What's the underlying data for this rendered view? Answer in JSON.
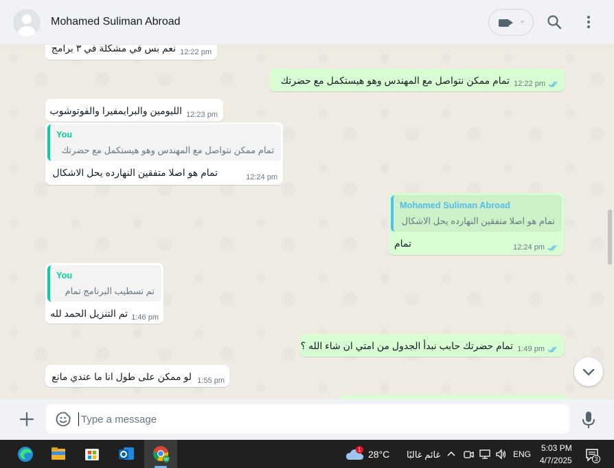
{
  "header": {
    "contact_name": "Mohamed Suliman Abroad",
    "icons": [
      "avatar-icon",
      "video-call-icon",
      "chevron-down-icon",
      "search-icon",
      "menu-icon"
    ]
  },
  "messages": [
    {
      "dir": "in",
      "text": "نعم بس في مشكلة في ٣ برامج",
      "time": "12:22 pm"
    },
    {
      "dir": "out",
      "text": "تمام ممكن نتواصل مع المهندس وهو هيستكمل مع حضرتك",
      "time": "12:22 pm"
    },
    {
      "dir": "in",
      "text": "الليومين والبرايمفيرا والفوتوشوب",
      "time": "12:23 pm"
    },
    {
      "dir": "in",
      "quote_author": "You",
      "quote_text": "تمام ممكن نتواصل مع المهندس وهو هيستكمل مع حضرتك",
      "text": "تمام هو اصلا متفقين النهارده يحل الاشكال",
      "time": "12:24 pm"
    },
    {
      "dir": "out",
      "quote_author": "Mohamed Suliman Abroad",
      "quote_text": "تمام هو اصلا متفقين النهارده يحل الاشكال",
      "text": "تمام",
      "time": "12:24 pm"
    },
    {
      "dir": "in",
      "quote_author": "You",
      "quote_text": "تم تسطيب البرنامج تمام",
      "text": "تم التنزيل الحمد لله",
      "time": "1:46 pm"
    },
    {
      "dir": "out",
      "text": "تمام حضرتك حابب نبدأ الجدول من امتي ان شاء الله ؟",
      "time": "1:49 pm"
    },
    {
      "dir": "in",
      "text": "لو ممكن على طول انا ما عندي مانع",
      "time": "1:55 pm"
    }
  ],
  "composer": {
    "placeholder": "Type a message"
  },
  "taskbar": {
    "weather_temp": "28°C",
    "weather_desc": "غائم غالبًا",
    "weather_badge": "1",
    "language": "ENG",
    "time": "5:03 PM",
    "date": "4/7/2025",
    "notification_count": "3"
  },
  "colors": {
    "incoming_bubble": "#ffffff",
    "outgoing_bubble": "#d9fdd3",
    "quote_you": "#06cf9c",
    "quote_contact": "#53bdeb",
    "read_ticks": "#53bdeb",
    "chat_background": "#efeae2"
  }
}
